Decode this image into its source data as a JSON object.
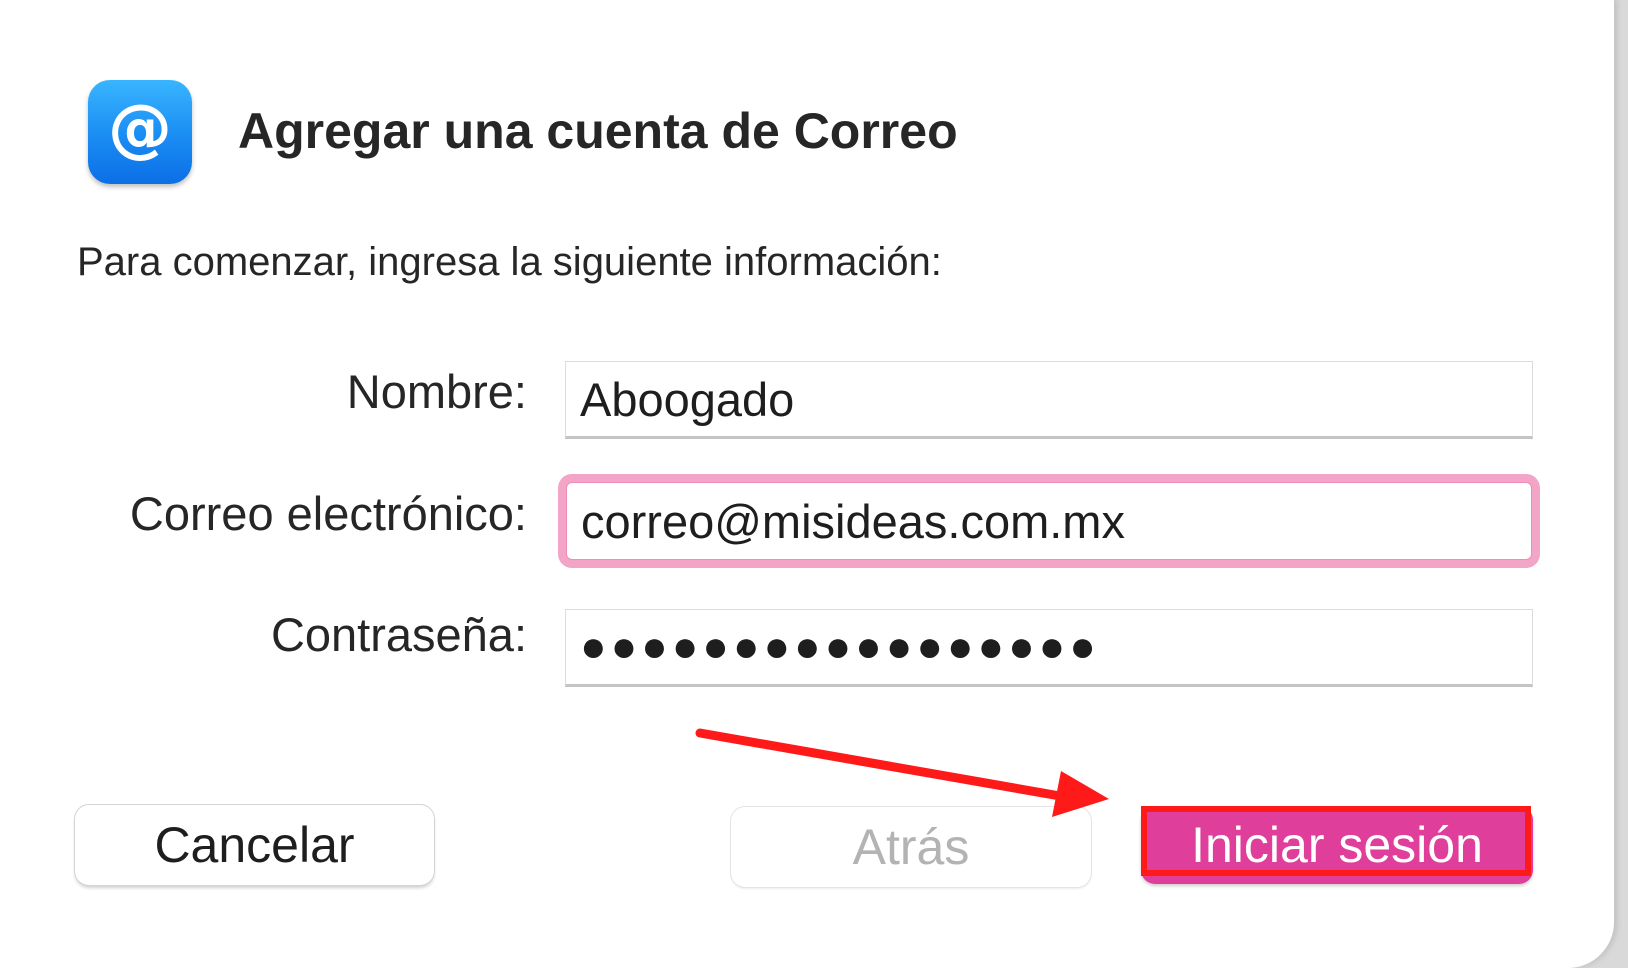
{
  "dialog": {
    "title": "Agregar una cuenta de Correo",
    "subtitle": "Para comenzar, ingresa la siguiente información:",
    "app_icon": "at-sign-icon"
  },
  "form": {
    "name_label": "Nombre:",
    "name_value": "Aboogado",
    "email_label": "Correo electrónico:",
    "email_value": "correo@misideas.com.mx",
    "password_label": "Contraseña:",
    "password_value": "●●●●●●●●●●●●●●●●●"
  },
  "buttons": {
    "cancel": "Cancelar",
    "back": "Atrás",
    "sign_in": "Iniciar sesión"
  },
  "colors": {
    "accent": "#df3e9a",
    "focus_ring": "#f3a5c8",
    "annotation": "#ff1a1a"
  }
}
